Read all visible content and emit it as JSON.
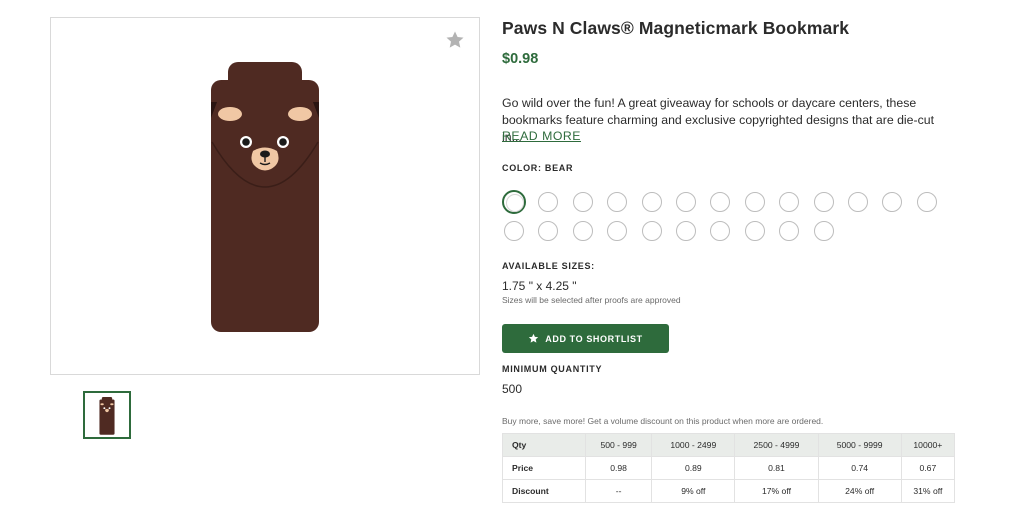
{
  "product": {
    "title": "Paws N Claws® Magneticmark Bookmark",
    "price": "$0.98",
    "description": "Go wild over the fun! A great giveaway for schools or daycare centers, these bookmarks feature charming and exclusive copyrighted designs that are die-cut in...",
    "read_more": "READ MORE",
    "image_icon": "bear-bookmark",
    "favorite_icon": "star-icon"
  },
  "color": {
    "label": "COLOR: BEAR",
    "swatch_count": 23,
    "selected_index": 0
  },
  "sizes": {
    "label": "AVAILABLE SIZES:",
    "value": "1.75 \" x 4.25 \"",
    "note": "Sizes will be selected after proofs are approved"
  },
  "shortlist": {
    "label": "ADD TO SHORTLIST",
    "icon": "star-icon"
  },
  "minimum_quantity": {
    "label": "MINIMUM QUANTITY",
    "value": "500"
  },
  "volume": {
    "note": "Buy more, save more! Get a volume discount on this product when more are ordered.",
    "headers": [
      "Qty",
      "500 - 999",
      "1000 - 2499",
      "2500 - 4999",
      "5000 - 9999",
      "10000+"
    ],
    "rows": [
      [
        "Price",
        "0.98",
        "0.89",
        "0.81",
        "0.74",
        "0.67"
      ],
      [
        "Discount",
        "--",
        "9% off",
        "17% off",
        "24% off",
        "31% off"
      ]
    ]
  },
  "colors": {
    "accent": "#2e6b3c",
    "bear_body": "#4f2a22",
    "bear_ear": "#f0c7a4",
    "table_header_bg": "#e9ece9"
  }
}
